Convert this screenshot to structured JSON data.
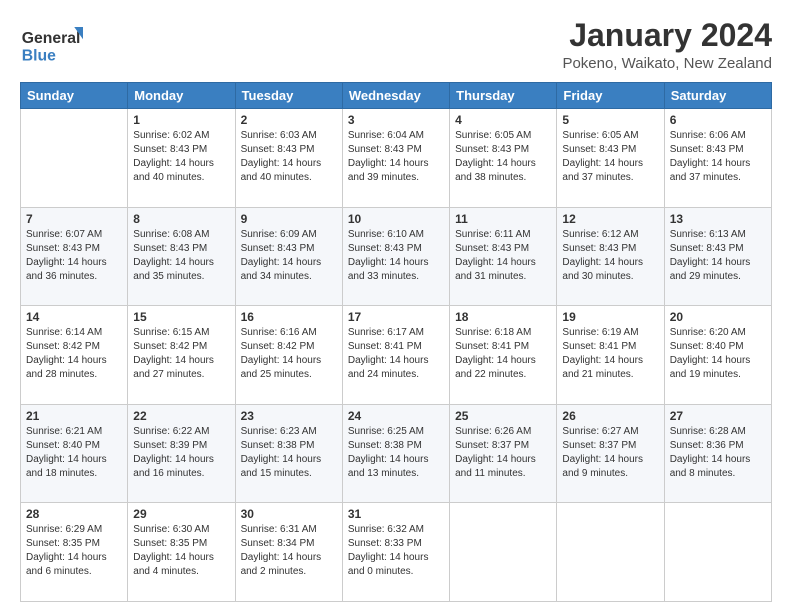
{
  "header": {
    "logo_line1": "General",
    "logo_line2": "Blue",
    "month_title": "January 2024",
    "location": "Pokeno, Waikato, New Zealand"
  },
  "weekdays": [
    "Sunday",
    "Monday",
    "Tuesday",
    "Wednesday",
    "Thursday",
    "Friday",
    "Saturday"
  ],
  "weeks": [
    [
      {
        "day": "",
        "info": ""
      },
      {
        "day": "1",
        "info": "Sunrise: 6:02 AM\nSunset: 8:43 PM\nDaylight: 14 hours\nand 40 minutes."
      },
      {
        "day": "2",
        "info": "Sunrise: 6:03 AM\nSunset: 8:43 PM\nDaylight: 14 hours\nand 40 minutes."
      },
      {
        "day": "3",
        "info": "Sunrise: 6:04 AM\nSunset: 8:43 PM\nDaylight: 14 hours\nand 39 minutes."
      },
      {
        "day": "4",
        "info": "Sunrise: 6:05 AM\nSunset: 8:43 PM\nDaylight: 14 hours\nand 38 minutes."
      },
      {
        "day": "5",
        "info": "Sunrise: 6:05 AM\nSunset: 8:43 PM\nDaylight: 14 hours\nand 37 minutes."
      },
      {
        "day": "6",
        "info": "Sunrise: 6:06 AM\nSunset: 8:43 PM\nDaylight: 14 hours\nand 37 minutes."
      }
    ],
    [
      {
        "day": "7",
        "info": "Sunrise: 6:07 AM\nSunset: 8:43 PM\nDaylight: 14 hours\nand 36 minutes."
      },
      {
        "day": "8",
        "info": "Sunrise: 6:08 AM\nSunset: 8:43 PM\nDaylight: 14 hours\nand 35 minutes."
      },
      {
        "day": "9",
        "info": "Sunrise: 6:09 AM\nSunset: 8:43 PM\nDaylight: 14 hours\nand 34 minutes."
      },
      {
        "day": "10",
        "info": "Sunrise: 6:10 AM\nSunset: 8:43 PM\nDaylight: 14 hours\nand 33 minutes."
      },
      {
        "day": "11",
        "info": "Sunrise: 6:11 AM\nSunset: 8:43 PM\nDaylight: 14 hours\nand 31 minutes."
      },
      {
        "day": "12",
        "info": "Sunrise: 6:12 AM\nSunset: 8:43 PM\nDaylight: 14 hours\nand 30 minutes."
      },
      {
        "day": "13",
        "info": "Sunrise: 6:13 AM\nSunset: 8:43 PM\nDaylight: 14 hours\nand 29 minutes."
      }
    ],
    [
      {
        "day": "14",
        "info": "Sunrise: 6:14 AM\nSunset: 8:42 PM\nDaylight: 14 hours\nand 28 minutes."
      },
      {
        "day": "15",
        "info": "Sunrise: 6:15 AM\nSunset: 8:42 PM\nDaylight: 14 hours\nand 27 minutes."
      },
      {
        "day": "16",
        "info": "Sunrise: 6:16 AM\nSunset: 8:42 PM\nDaylight: 14 hours\nand 25 minutes."
      },
      {
        "day": "17",
        "info": "Sunrise: 6:17 AM\nSunset: 8:41 PM\nDaylight: 14 hours\nand 24 minutes."
      },
      {
        "day": "18",
        "info": "Sunrise: 6:18 AM\nSunset: 8:41 PM\nDaylight: 14 hours\nand 22 minutes."
      },
      {
        "day": "19",
        "info": "Sunrise: 6:19 AM\nSunset: 8:41 PM\nDaylight: 14 hours\nand 21 minutes."
      },
      {
        "day": "20",
        "info": "Sunrise: 6:20 AM\nSunset: 8:40 PM\nDaylight: 14 hours\nand 19 minutes."
      }
    ],
    [
      {
        "day": "21",
        "info": "Sunrise: 6:21 AM\nSunset: 8:40 PM\nDaylight: 14 hours\nand 18 minutes."
      },
      {
        "day": "22",
        "info": "Sunrise: 6:22 AM\nSunset: 8:39 PM\nDaylight: 14 hours\nand 16 minutes."
      },
      {
        "day": "23",
        "info": "Sunrise: 6:23 AM\nSunset: 8:38 PM\nDaylight: 14 hours\nand 15 minutes."
      },
      {
        "day": "24",
        "info": "Sunrise: 6:25 AM\nSunset: 8:38 PM\nDaylight: 14 hours\nand 13 minutes."
      },
      {
        "day": "25",
        "info": "Sunrise: 6:26 AM\nSunset: 8:37 PM\nDaylight: 14 hours\nand 11 minutes."
      },
      {
        "day": "26",
        "info": "Sunrise: 6:27 AM\nSunset: 8:37 PM\nDaylight: 14 hours\nand 9 minutes."
      },
      {
        "day": "27",
        "info": "Sunrise: 6:28 AM\nSunset: 8:36 PM\nDaylight: 14 hours\nand 8 minutes."
      }
    ],
    [
      {
        "day": "28",
        "info": "Sunrise: 6:29 AM\nSunset: 8:35 PM\nDaylight: 14 hours\nand 6 minutes."
      },
      {
        "day": "29",
        "info": "Sunrise: 6:30 AM\nSunset: 8:35 PM\nDaylight: 14 hours\nand 4 minutes."
      },
      {
        "day": "30",
        "info": "Sunrise: 6:31 AM\nSunset: 8:34 PM\nDaylight: 14 hours\nand 2 minutes."
      },
      {
        "day": "31",
        "info": "Sunrise: 6:32 AM\nSunset: 8:33 PM\nDaylight: 14 hours\nand 0 minutes."
      },
      {
        "day": "",
        "info": ""
      },
      {
        "day": "",
        "info": ""
      },
      {
        "day": "",
        "info": ""
      }
    ]
  ]
}
